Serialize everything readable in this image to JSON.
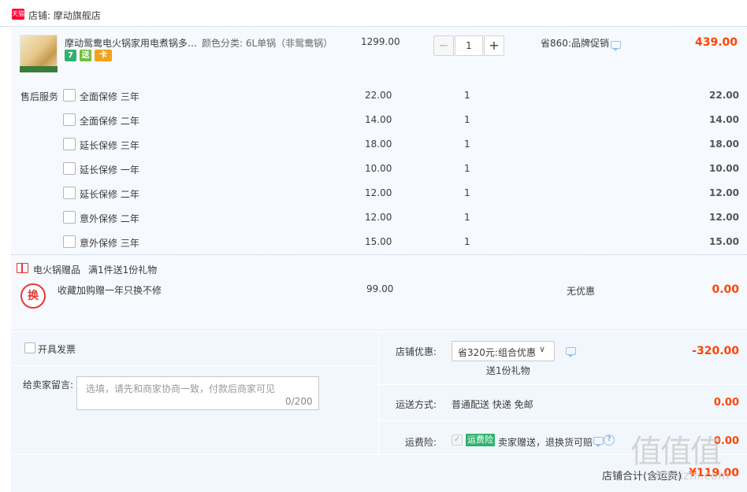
{
  "shop": {
    "badge": "天猫",
    "label": "店铺: 摩动旗舰店"
  },
  "product": {
    "title": "摩动鸳鸯电火锅家用电煮锅多功...",
    "spec": "颜色分类: 6L单锅（非鸳鸯锅）",
    "icons": [
      "7",
      "送",
      "卡"
    ],
    "unit_price": "1299.00",
    "quantity": "1",
    "minus": "−",
    "plus": "+",
    "promotion": "省860:品牌促销",
    "subtotal": "439.00"
  },
  "services": {
    "label": "售后服务",
    "items": [
      {
        "name": "全面保修 三年",
        "price": "22.00",
        "qty": "1",
        "total": "22.00"
      },
      {
        "name": "全面保修 二年",
        "price": "14.00",
        "qty": "1",
        "total": "14.00"
      },
      {
        "name": "延长保修 三年",
        "price": "18.00",
        "qty": "1",
        "total": "18.00"
      },
      {
        "name": "延长保修 一年",
        "price": "10.00",
        "qty": "1",
        "total": "10.00"
      },
      {
        "name": "延长保修 二年",
        "price": "12.00",
        "qty": "1",
        "total": "12.00"
      },
      {
        "name": "意外保修 二年",
        "price": "12.00",
        "qty": "1",
        "total": "12.00"
      },
      {
        "name": "意外保修 三年",
        "price": "15.00",
        "qty": "1",
        "total": "15.00"
      }
    ]
  },
  "gift": {
    "title": "电火锅赠品",
    "rule": "满1件送1份礼物",
    "badge": "换",
    "item_name": "收藏加购赠一年只换不修",
    "item_price": "99.00",
    "item_discount": "无优惠",
    "item_total": "0.00"
  },
  "invoice": {
    "label": "开具发票"
  },
  "memo": {
    "label": "给卖家留言:",
    "placeholder": "选填，请先和商家协商一致，付款后商家可见",
    "count": "0/200"
  },
  "discount": {
    "label": "店铺优惠:",
    "selected": "省320元:组合优惠",
    "chevron": "∨",
    "gift": "送1份礼物",
    "value": "-320.00"
  },
  "shipping": {
    "label": "运送方式:",
    "method": "普通配送 快递 免邮",
    "fee": "0.00"
  },
  "insurance": {
    "label": "运费险:",
    "check": "✓",
    "badge": "运费险",
    "desc": "卖家赠送，退换货可赔",
    "help": "?",
    "fee": "0.00"
  },
  "total": {
    "label": "店铺合计(含运费)",
    "value": "¥119.00"
  },
  "watermark": {
    "logo": "值值值",
    "url": "zhizhizhi.com"
  },
  "colors": {
    "accent": "#ff4400",
    "panel_bg": "#f6f9fd",
    "bottom_bg": "#f2f7fd",
    "tmall_red": "#ff0036",
    "insurance_green": "#2fb36c"
  },
  "icon_names": [
    "tmall-badge-icon",
    "seven-day-return-icon",
    "delivery-icon",
    "card-icon",
    "chat-icon",
    "gift-icon",
    "swap-icon",
    "help-icon",
    "chevron-down-icon"
  ]
}
